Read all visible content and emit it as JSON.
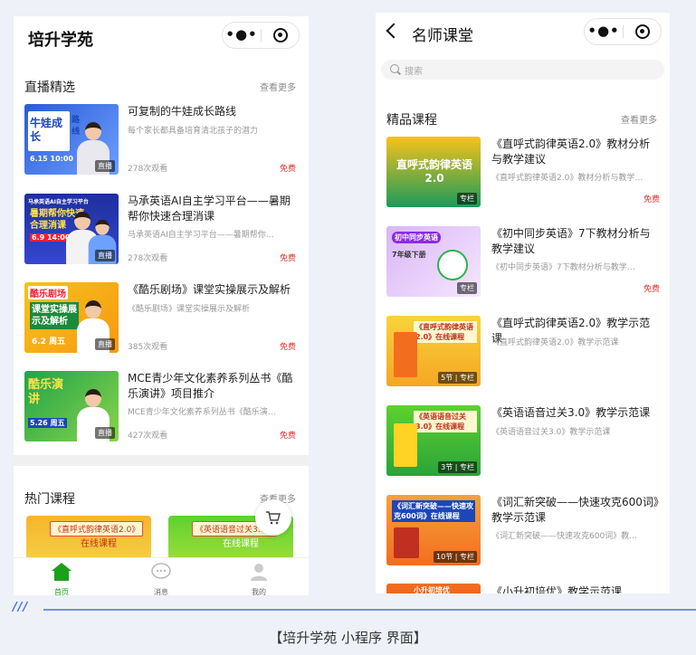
{
  "left": {
    "app_title": "培升学苑",
    "live": {
      "title": "直播精选",
      "see_more": "查看更多",
      "items": [
        {
          "title": "可复制的牛娃成长路线",
          "subtitle": "每个家长都具备培育清北孩子的潜力",
          "views": "278次观看",
          "price": "免费",
          "badge": "直播",
          "thumb_text": "牛娃成长",
          "thumb_side": "路线",
          "thumb_date": "6.15 10:00"
        },
        {
          "title": "马承英语AI自主学习平台——暑期帮你快速合理消课",
          "subtitle": "马承英语AI自主学习平台——暑期帮你…",
          "views": "278次观看",
          "price": "免费",
          "badge": "直播",
          "thumb_text": "暑期帮你快速合理消课",
          "thumb_top": "马承英语AI自主学习平台",
          "thumb_date": "6.9 14:00"
        },
        {
          "title": "《酷乐剧场》课堂实操展示及解析",
          "subtitle": "《酷乐剧场》课堂实操展示及解析",
          "views": "385次观看",
          "price": "免费",
          "badge": "直播",
          "thumb_text": "课堂实操展示及解析",
          "thumb_top": "酷乐剧场",
          "thumb_date": "6.2 周五"
        },
        {
          "title": "MCE青少年文化素养系列丛书《酷乐演讲》项目推介",
          "subtitle": "MCE青少年文化素养系列丛书《酷乐演…",
          "views": "427次观看",
          "price": "免费",
          "badge": "直播",
          "thumb_text": "酷乐演讲",
          "thumb_date": "5.26 周五"
        }
      ]
    },
    "hot": {
      "title": "热门课程",
      "see_more": "查看更多",
      "cards": [
        {
          "tag": "《直呼式韵律英语2.0》",
          "sub": "在线课程"
        },
        {
          "tag": "《英语语音过关3.0》",
          "sub": "在线课程"
        }
      ]
    },
    "tabs": [
      {
        "label": "首页",
        "icon": "home-icon",
        "active": true
      },
      {
        "label": "消息",
        "icon": "chat-icon",
        "active": false
      },
      {
        "label": "我的",
        "icon": "user-icon",
        "active": false
      }
    ]
  },
  "right": {
    "page_title": "名师课堂",
    "search_placeholder": "搜索",
    "section": {
      "title": "精品课程",
      "see_more": "查看更多"
    },
    "items": [
      {
        "title": "《直呼式韵律英语2.0》教材分析与教学建议",
        "subtitle": "《直呼式韵律英语2.0》教材分析与教学…",
        "price": "免费",
        "badge": "专栏",
        "thumb_text": "直呼式韵律英语2.0"
      },
      {
        "title": "《初中同步英语》7下教材分析与教学建议",
        "subtitle": "《初中同步英语》7下教材分析与教学…",
        "price": "免费",
        "badge": "专栏",
        "thumb_text": "初中同步英语",
        "thumb_side": "7年级下册"
      },
      {
        "title": "《直呼式韵律英语2.0》教学示范课",
        "subtitle": "《直呼式韵律英语2.0》教学示范课",
        "price": "",
        "badge": "5节 | 专栏",
        "thumb_text": "《直呼式韵律英语2.0》在线课程"
      },
      {
        "title": "《英语语音过关3.0》教学示范课",
        "subtitle": "《英语语音过关3.0》教学示范课",
        "price": "",
        "badge": "3节 | 专栏",
        "thumb_text": "《英语语音过关3.0》在线课程"
      },
      {
        "title": "《词汇新突破——快速攻克600词》教学示范课",
        "subtitle": "《词汇新突破——快速攻克600词》教…",
        "price": "",
        "badge": "10节 | 专栏",
        "thumb_text": "《词汇新突破——快速攻克600词》在线课程"
      },
      {
        "title": "《小升初培优》教学示范课",
        "subtitle": "",
        "price": "",
        "badge": "",
        "thumb_text": "小升初培优"
      }
    ]
  },
  "caption": "【培升学苑 小程序 界面】",
  "divider_slashes": "///",
  "colors": {
    "accent_green": "#1aa01a",
    "price_red": "#e0312f",
    "divider_blue": "#6f8fe8"
  }
}
